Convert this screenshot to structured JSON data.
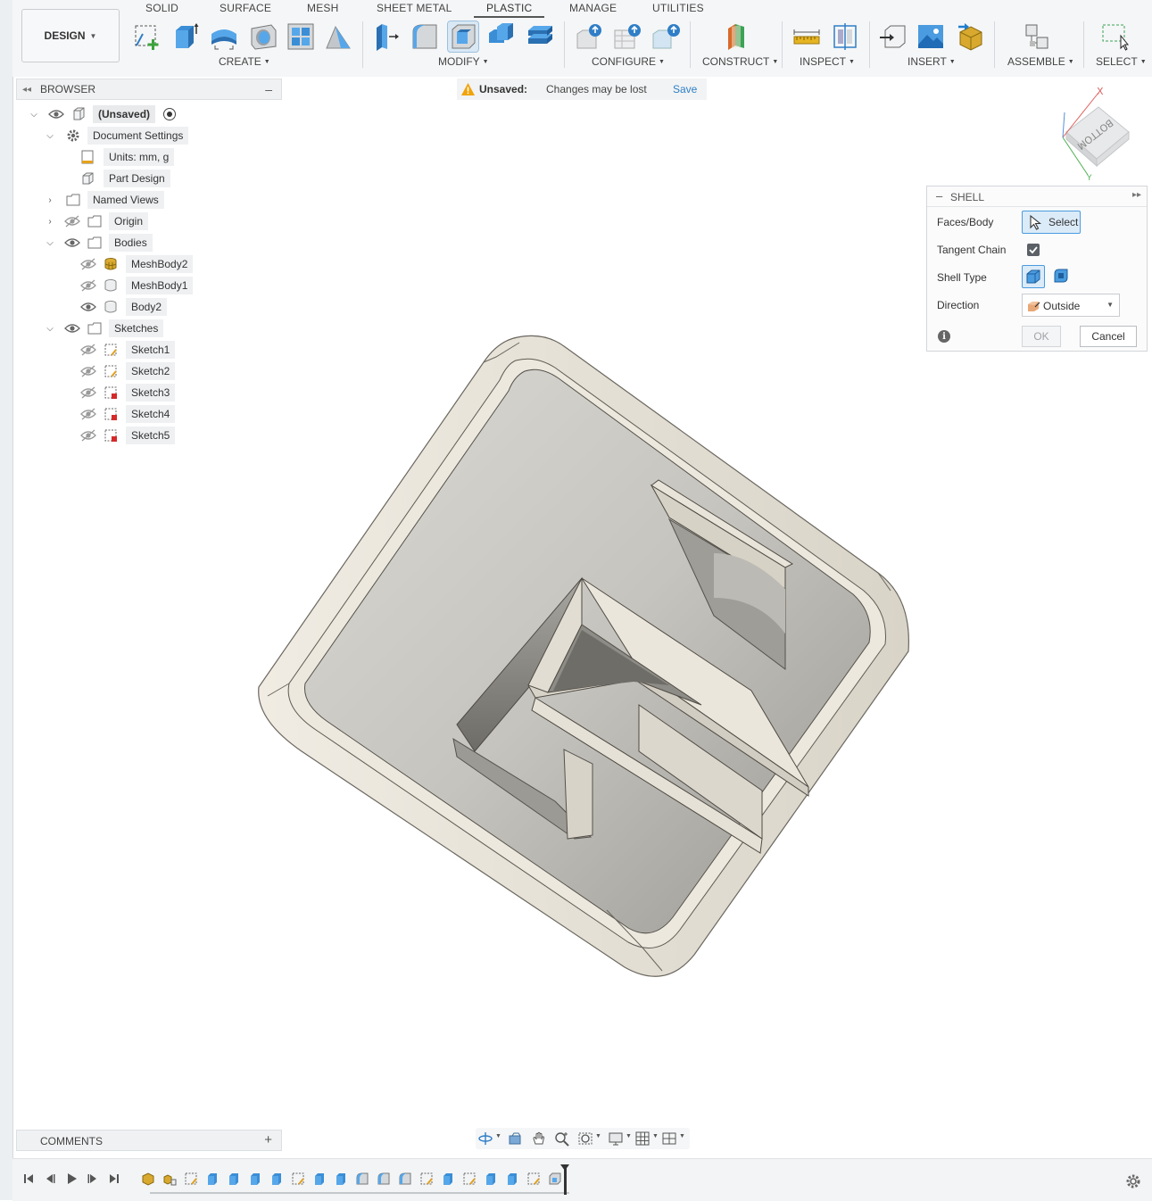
{
  "workspace": {
    "label": "DESIGN"
  },
  "tabs": [
    {
      "label": "SOLID"
    },
    {
      "label": "SURFACE"
    },
    {
      "label": "MESH"
    },
    {
      "label": "SHEET METAL"
    },
    {
      "label": "PLASTIC",
      "active": true
    },
    {
      "label": "MANAGE"
    },
    {
      "label": "UTILITIES"
    }
  ],
  "groups": {
    "create": "CREATE",
    "modify": "MODIFY",
    "configure": "CONFIGURE",
    "construct": "CONSTRUCT",
    "inspect": "INSPECT",
    "insert": "INSERT",
    "assemble": "ASSEMBLE",
    "select": "SELECT"
  },
  "browser": {
    "title": "BROWSER",
    "root": "(Unsaved)",
    "document_settings": "Document Settings",
    "units": "Units: mm, g",
    "part_design": "Part Design",
    "named_views": "Named Views",
    "origin": "Origin",
    "bodies": "Bodies",
    "body_items": [
      "MeshBody2",
      "MeshBody1",
      "Body2"
    ],
    "sketches": "Sketches",
    "sketch_items": [
      "Sketch1",
      "Sketch2",
      "Sketch3",
      "Sketch4",
      "Sketch5"
    ]
  },
  "banner": {
    "status": "Unsaved:",
    "message": "Changes may be lost",
    "action": "Save"
  },
  "viewcube": {
    "face": "BOTTOM",
    "x_axis": "X",
    "y_axis": "Y"
  },
  "shell_dialog": {
    "title": "SHELL",
    "faces_body_label": "Faces/Body",
    "select_label": "Select",
    "tangent_chain_label": "Tangent Chain",
    "tangent_chain_checked": true,
    "shell_type_label": "Shell Type",
    "direction_label": "Direction",
    "direction_value": "Outside",
    "ok_label": "OK",
    "cancel_label": "Cancel"
  },
  "comments": {
    "title": "COMMENTS"
  },
  "colors": {
    "accent": "#2d7fc6",
    "select_highlight": "#dcebf8",
    "model_face": "#e6e1d6",
    "model_shadow": "#a9a59d",
    "warning": "#f0a30a"
  }
}
